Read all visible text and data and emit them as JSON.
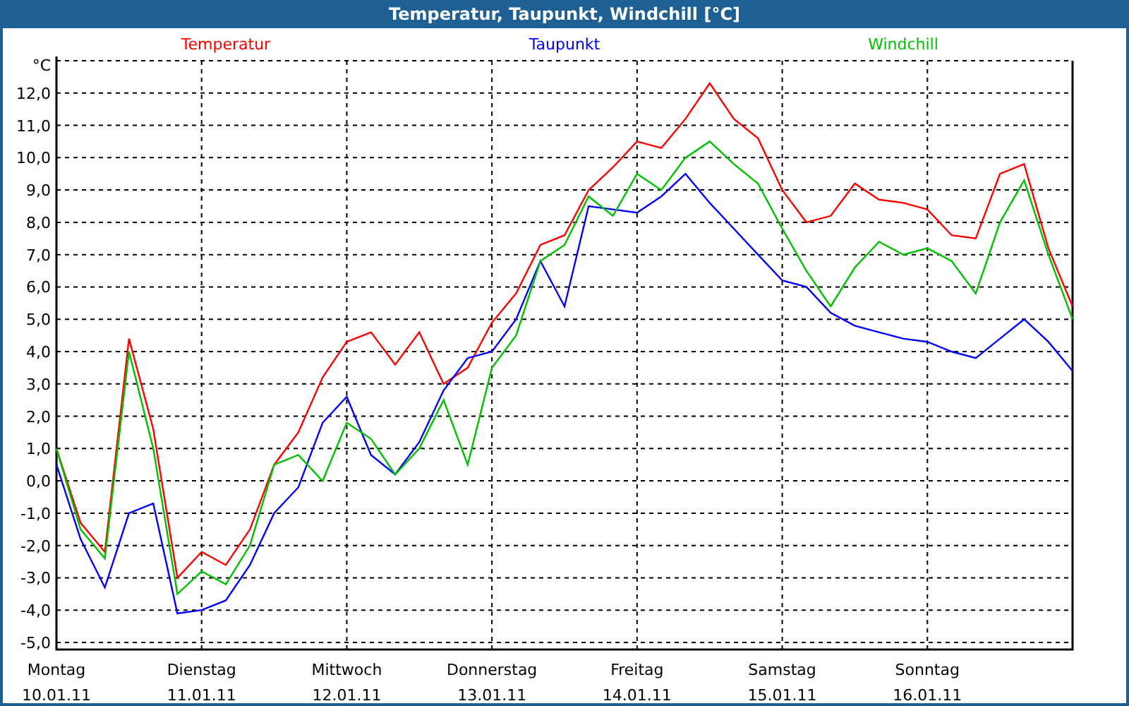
{
  "window": {
    "title": "Temperatur, Taupunkt, Windchill [°C]"
  },
  "chart": {
    "unit": "°C",
    "dates": [
      "10.01.11",
      "11.01.11",
      "12.01.11",
      "13.01.11",
      "14.01.11",
      "15.01.11",
      "16.01.11"
    ],
    "chart_data": {
      "type": "line",
      "categories": [
        "Montag",
        null,
        null,
        null,
        null,
        null,
        "Dienstag",
        null,
        null,
        null,
        null,
        null,
        "Mittwoch",
        null,
        null,
        null,
        null,
        null,
        "Donnerstag",
        null,
        null,
        null,
        null,
        null,
        "Freitag",
        null,
        null,
        null,
        null,
        null,
        "Samstag",
        null,
        null,
        null,
        null,
        null,
        "Sonntag",
        null,
        null,
        null,
        null,
        null,
        null
      ],
      "ylim": [
        -5,
        13
      ],
      "grid": true,
      "yticks": [
        {
          "value": -5,
          "label": "-5,0"
        },
        {
          "value": -4,
          "label": "-4,0"
        },
        {
          "value": -3,
          "label": "-3,0"
        },
        {
          "value": -2,
          "label": "-2,0"
        },
        {
          "value": -1,
          "label": "-1,0"
        },
        {
          "value": 0,
          "label": "0,0"
        },
        {
          "value": 1,
          "label": "1,0"
        },
        {
          "value": 2,
          "label": "2,0"
        },
        {
          "value": 3,
          "label": "3,0"
        },
        {
          "value": 4,
          "label": "4,0"
        },
        {
          "value": 5,
          "label": "5,0"
        },
        {
          "value": 6,
          "label": "6,0"
        },
        {
          "value": 7,
          "label": "7,0"
        },
        {
          "value": 8,
          "label": "8,0"
        },
        {
          "value": 9,
          "label": "9,0"
        },
        {
          "value": 10,
          "label": "10,0"
        },
        {
          "value": 11,
          "label": "11,0"
        },
        {
          "value": 12,
          "label": "12,0"
        }
      ],
      "series": [
        {
          "name": "Temperatur",
          "color": "#ff0000",
          "values": [
            1.0,
            -1.3,
            -2.2,
            4.4,
            1.6,
            -3.0,
            -2.2,
            -2.6,
            -1.5,
            0.5,
            1.5,
            3.2,
            4.3,
            4.6,
            3.6,
            4.6,
            3.0,
            3.5,
            4.9,
            5.8,
            7.3,
            7.6,
            9.0,
            9.7,
            10.5,
            10.3,
            11.2,
            12.3,
            11.2,
            10.6,
            9.0,
            8.0,
            8.2,
            9.2,
            8.7,
            8.6,
            8.4,
            7.6,
            7.5,
            9.5,
            9.8,
            7.2,
            5.4
          ]
        },
        {
          "name": "Taupunkt",
          "color": "#0000ff",
          "values": [
            0.5,
            -1.8,
            -3.3,
            -1.0,
            -0.7,
            -4.1,
            -4.0,
            -3.7,
            -2.6,
            -1.0,
            -0.2,
            1.8,
            2.6,
            0.8,
            0.2,
            1.2,
            2.8,
            3.8,
            4.0,
            5.0,
            6.8,
            5.4,
            8.5,
            8.4,
            8.3,
            8.8,
            9.5,
            8.6,
            7.8,
            7.0,
            6.2,
            6.0,
            5.2,
            4.8,
            4.6,
            4.4,
            4.3,
            4.0,
            3.8,
            4.4,
            5.0,
            4.3,
            3.4
          ]
        },
        {
          "name": "Windchill",
          "color": "#00c000",
          "values": [
            1.0,
            -1.5,
            -2.4,
            4.0,
            1.0,
            -3.5,
            -2.8,
            -3.2,
            -2.0,
            0.5,
            0.8,
            0.0,
            1.8,
            1.3,
            0.2,
            1.0,
            2.5,
            0.5,
            3.5,
            4.5,
            6.8,
            7.3,
            8.8,
            8.2,
            9.5,
            9.0,
            10.0,
            10.5,
            9.8,
            9.2,
            7.8,
            6.5,
            5.4,
            6.6,
            7.4,
            7.0,
            7.2,
            6.8,
            5.8,
            8.0,
            9.3,
            7.0,
            5.0
          ]
        }
      ]
    }
  }
}
